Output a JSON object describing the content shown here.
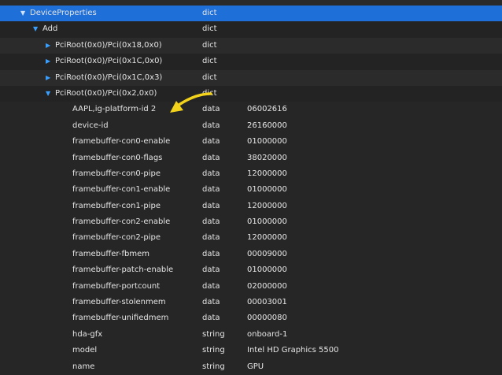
{
  "tree": {
    "root": {
      "key": "DeviceProperties",
      "type": "dict",
      "expanded": true
    },
    "add": {
      "key": "Add",
      "type": "dict",
      "expanded": true
    },
    "collapsed_entries": [
      {
        "key": "PciRoot(0x0)/Pci(0x18,0x0)",
        "type": "dict"
      },
      {
        "key": "PciRoot(0x0)/Pci(0x1C,0x0)",
        "type": "dict"
      },
      {
        "key": "PciRoot(0x0)/Pci(0x1C,0x3)",
        "type": "dict"
      }
    ],
    "expanded_entry": {
      "key": "PciRoot(0x0)/Pci(0x2,0x0)",
      "type": "dict"
    },
    "properties": [
      {
        "key": "AAPL,ig-platform-id 2",
        "type": "data",
        "value": "06002616"
      },
      {
        "key": "device-id",
        "type": "data",
        "value": "26160000"
      },
      {
        "key": "framebuffer-con0-enable",
        "type": "data",
        "value": "01000000"
      },
      {
        "key": "framebuffer-con0-flags",
        "type": "data",
        "value": "38020000"
      },
      {
        "key": "framebuffer-con0-pipe",
        "type": "data",
        "value": "12000000"
      },
      {
        "key": "framebuffer-con1-enable",
        "type": "data",
        "value": "01000000"
      },
      {
        "key": "framebuffer-con1-pipe",
        "type": "data",
        "value": "12000000"
      },
      {
        "key": "framebuffer-con2-enable",
        "type": "data",
        "value": "01000000"
      },
      {
        "key": "framebuffer-con2-pipe",
        "type": "data",
        "value": "12000000"
      },
      {
        "key": "framebuffer-fbmem",
        "type": "data",
        "value": "00009000"
      },
      {
        "key": "framebuffer-patch-enable",
        "type": "data",
        "value": "01000000"
      },
      {
        "key": "framebuffer-portcount",
        "type": "data",
        "value": "02000000"
      },
      {
        "key": "framebuffer-stolenmem",
        "type": "data",
        "value": "00003001"
      },
      {
        "key": "framebuffer-unifiedmem",
        "type": "data",
        "value": "00000080"
      },
      {
        "key": "hda-gfx",
        "type": "string",
        "value": "onboard-1"
      },
      {
        "key": "model",
        "type": "string",
        "value": "Intel HD Graphics 5500"
      },
      {
        "key": "name",
        "type": "string",
        "value": "GPU"
      }
    ]
  },
  "colors": {
    "selected_row": "#1f6fd8",
    "disclosure": "#3aa0ff",
    "annotation_arrow": "#f2d21b"
  },
  "icons": {
    "disclosure_open": "triangle-down-icon",
    "disclosure_closed": "triangle-right-icon",
    "annotation": "arrow-icon"
  }
}
